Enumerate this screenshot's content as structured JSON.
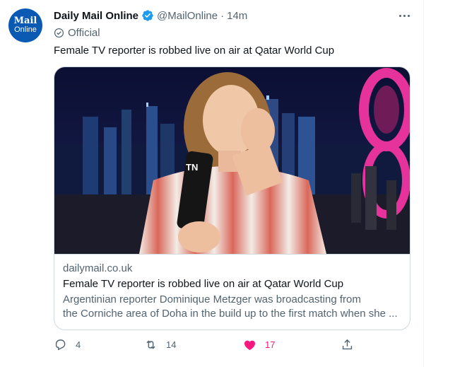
{
  "tweet": {
    "avatar": {
      "line1": "Mail",
      "line2": "Online"
    },
    "author_name": "Daily Mail Online",
    "handle": "@MailOnline",
    "separator": "·",
    "time": "14m",
    "label": "Official",
    "text": "Female TV reporter is robbed live on air at Qatar World Cup"
  },
  "card": {
    "image_alt": "Reporter speaking into a microphone at night in Doha",
    "mic_logo": "TN",
    "domain": "dailymail.co.uk",
    "title": "Female TV reporter is robbed live on air at Qatar World Cup",
    "description_line1": "Argentinian reporter Dominique Metzger was broadcasting from",
    "description_line2": "the Corniche area of Doha in the build up to the first match when she ..."
  },
  "actions": {
    "replies": "4",
    "retweets": "14",
    "likes": "17"
  },
  "colors": {
    "brand_blue": "#0a5ab4",
    "verified_blue": "#1d9bf0",
    "like_pink": "#f91880",
    "secondary_text": "#536471"
  },
  "icons": [
    "verified-badge-icon",
    "more-options-icon",
    "official-badge-icon",
    "reply-icon",
    "retweet-icon",
    "like-heart-icon",
    "share-icon"
  ]
}
